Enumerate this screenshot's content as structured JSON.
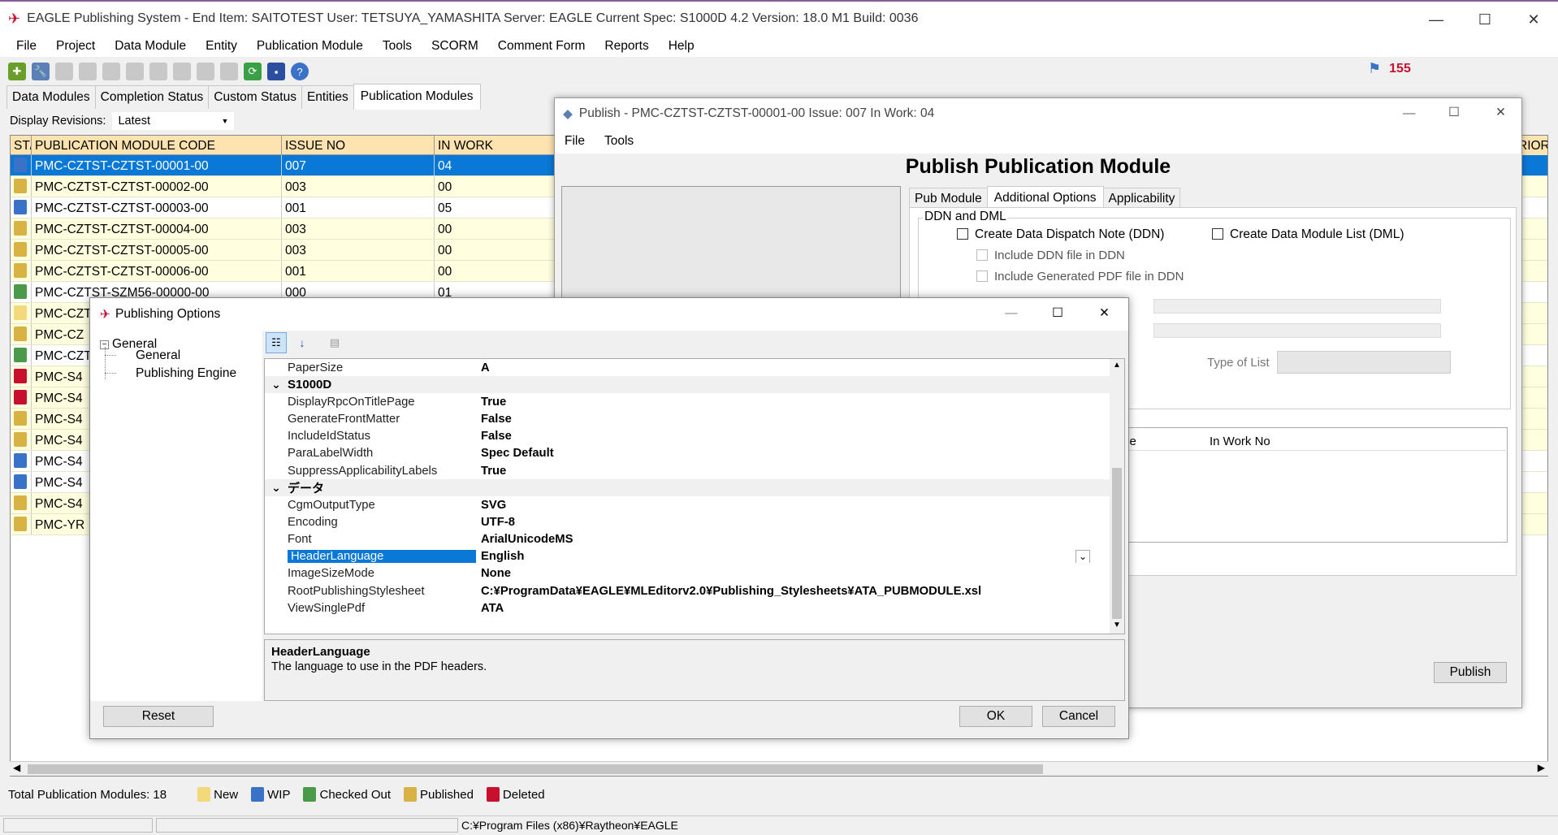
{
  "app": {
    "title": "EAGLE Publishing System - End Item: SAITOTEST   User: TETSUYA_YAMASHITA    Server: EAGLE    Current Spec: S1000D 4.2    Version: 18.0 M1 Build: 0036",
    "notif_count": "155"
  },
  "menu": [
    "File",
    "Project",
    "Data Module",
    "Entity",
    "Publication Module",
    "Tools",
    "SCORM",
    "Comment Form",
    "Reports",
    "Help"
  ],
  "tabs": [
    "Data Modules",
    "Completion Status",
    "Custom Status",
    "Entities",
    "Publication Modules"
  ],
  "display_revisions": {
    "label": "Display Revisions:",
    "value": "Latest"
  },
  "grid": {
    "headers": [
      "ST/",
      "PUBLICATION MODULE CODE",
      "ISSUE NO",
      "IN WORK"
    ],
    "extra_header": "RIOR",
    "rows": [
      {
        "code": "PMC-CZTST-CZTST-00001-00",
        "issue": "007",
        "inwork": "04",
        "status": "wip"
      },
      {
        "code": "PMC-CZTST-CZTST-00002-00",
        "issue": "003",
        "inwork": "00",
        "status": "published"
      },
      {
        "code": "PMC-CZTST-CZTST-00003-00",
        "issue": "001",
        "inwork": "05",
        "status": "wip"
      },
      {
        "code": "PMC-CZTST-CZTST-00004-00",
        "issue": "003",
        "inwork": "00",
        "status": "published"
      },
      {
        "code": "PMC-CZTST-CZTST-00005-00",
        "issue": "003",
        "inwork": "00",
        "status": "published"
      },
      {
        "code": "PMC-CZTST-CZTST-00006-00",
        "issue": "001",
        "inwork": "00",
        "status": "published"
      },
      {
        "code": "PMC-CZTST-SZM56-00000-00",
        "issue": "000",
        "inwork": "01",
        "status": "checked"
      },
      {
        "code": "PMC-CZT",
        "issue": "",
        "inwork": "",
        "status": "new"
      },
      {
        "code": "PMC-CZ",
        "issue": "",
        "inwork": "",
        "status": "published"
      },
      {
        "code": "PMC-CZT",
        "issue": "",
        "inwork": "",
        "status": "checked"
      },
      {
        "code": "PMC-S4",
        "issue": "",
        "inwork": "",
        "status": "deleted"
      },
      {
        "code": "PMC-S4",
        "issue": "",
        "inwork": "",
        "status": "deleted"
      },
      {
        "code": "PMC-S4",
        "issue": "",
        "inwork": "",
        "status": "published"
      },
      {
        "code": "PMC-S4",
        "issue": "",
        "inwork": "",
        "status": "published"
      },
      {
        "code": "PMC-S4",
        "issue": "",
        "inwork": "",
        "status": "wip"
      },
      {
        "code": "PMC-S4",
        "issue": "",
        "inwork": "",
        "status": "wip"
      },
      {
        "code": "PMC-S4",
        "issue": "",
        "inwork": "",
        "status": "published"
      },
      {
        "code": "PMC-YR",
        "issue": "",
        "inwork": "",
        "status": "published"
      }
    ]
  },
  "legend": {
    "total": "Total Publication Modules: 18",
    "new": "New",
    "wip": "WIP",
    "checked": "Checked Out",
    "published": "Published",
    "deleted": "Deleted"
  },
  "statusbar": {
    "path": "C:¥Program Files (x86)¥Raytheon¥EAGLE"
  },
  "publish": {
    "title": "Publish - PMC-CZTST-CZTST-00001-00 Issue: 007 In Work: 04",
    "menu": [
      "File",
      "Tools"
    ],
    "heading": "Publish Publication Module",
    "tabs": [
      "Pub Module",
      "Additional Options",
      "Applicability"
    ],
    "group": "DDN and DML",
    "ddn": "Create Data Dispatch Note (DDN)",
    "dml": "Create Data Module List (DML)",
    "inc_ddn": "Include DDN file in DDN",
    "inc_pdf": "Include Generated PDF file in DDN",
    "type_of_list": "Type of List",
    "col_issue": "Issue",
    "col_inwork": "In Work No",
    "publish_btn": "Publish"
  },
  "options": {
    "title": "Publishing Options",
    "tree": [
      "General",
      "General",
      "Publishing Engine"
    ],
    "props": [
      {
        "type": "row",
        "name": "PaperSize",
        "value": "A"
      },
      {
        "type": "cat",
        "name": "S1000D"
      },
      {
        "type": "row",
        "name": "DisplayRpcOnTitlePage",
        "value": "True"
      },
      {
        "type": "row",
        "name": "GenerateFrontMatter",
        "value": "False"
      },
      {
        "type": "row",
        "name": "IncludeIdStatus",
        "value": "False"
      },
      {
        "type": "row",
        "name": "ParaLabelWidth",
        "value": "Spec Default"
      },
      {
        "type": "row",
        "name": "SuppressApplicabilityLabels",
        "value": "True"
      },
      {
        "type": "cat",
        "name": "データ"
      },
      {
        "type": "row",
        "name": "CgmOutputType",
        "value": "SVG"
      },
      {
        "type": "row",
        "name": "Encoding",
        "value": "UTF-8"
      },
      {
        "type": "row",
        "name": "Font",
        "value": "ArialUnicodeMS"
      },
      {
        "type": "row",
        "name": "HeaderLanguage",
        "value": "English",
        "selected": true
      },
      {
        "type": "row",
        "name": "ImageSizeMode",
        "value": "None"
      },
      {
        "type": "row",
        "name": "RootPublishingStylesheet",
        "value": "C:¥ProgramData¥EAGLE¥MLEditorv2.0¥Publishing_Stylesheets¥ATA_PUBMODULE.xsl"
      },
      {
        "type": "row",
        "name": "ViewSinglePdf",
        "value": "ATA"
      }
    ],
    "desc_title": "HeaderLanguage",
    "desc_text": "The language to use in the PDF headers.",
    "reset": "Reset",
    "ok": "OK",
    "cancel": "Cancel"
  },
  "colors": {
    "selection": "#0a78d7",
    "header": "#fde3b0",
    "rowyellow": "#ffffe0"
  }
}
